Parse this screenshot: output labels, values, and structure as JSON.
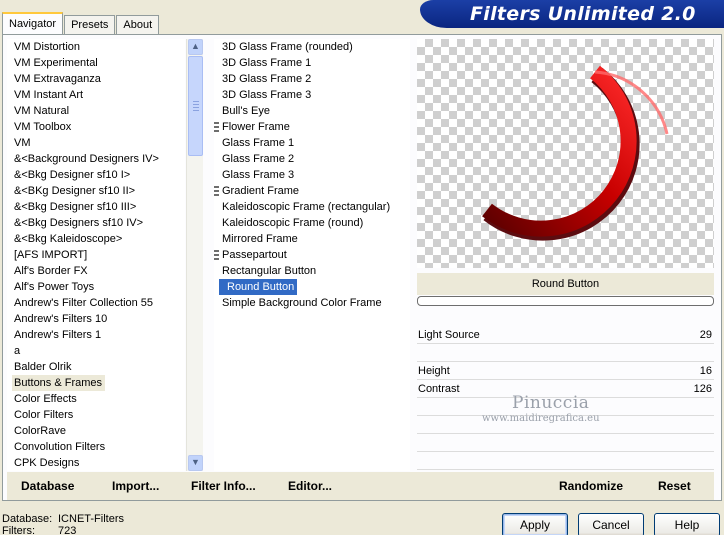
{
  "app": {
    "title": "Filters Unlimited 2.0"
  },
  "tabs": [
    {
      "label": "Navigator",
      "active": true
    },
    {
      "label": "Presets",
      "active": false
    },
    {
      "label": "About",
      "active": false
    }
  ],
  "categories": [
    "VM Distortion",
    "VM Experimental",
    "VM Extravaganza",
    "VM Instant Art",
    "VM Natural",
    "VM Toolbox",
    "VM",
    "&<Background Designers IV>",
    "&<Bkg Designer sf10 I>",
    "&<BKg Designer sf10 II>",
    "&<Bkg Designer sf10 III>",
    "&<Bkg Designers sf10 IV>",
    "&<Bkg Kaleidoscope>",
    "[AFS IMPORT]",
    "Alf's Border FX",
    "Alf's Power Toys",
    "Andrew's Filter Collection 55",
    "Andrew's Filters 10",
    "Andrew's Filters 1",
    "a",
    "Balder Olrik",
    "Buttons & Frames",
    "Color Effects",
    "Color Filters",
    "ColorRave",
    "Convolution Filters",
    "CPK Designs"
  ],
  "selected_category": "Buttons & Frames",
  "filters": [
    {
      "label": "3D Glass Frame (rounded)",
      "marked": false
    },
    {
      "label": "3D Glass Frame 1",
      "marked": false
    },
    {
      "label": "3D Glass Frame 2",
      "marked": false
    },
    {
      "label": "3D Glass Frame 3",
      "marked": false
    },
    {
      "label": "Bull's Eye",
      "marked": false
    },
    {
      "label": "Flower Frame",
      "marked": true
    },
    {
      "label": "Glass Frame 1",
      "marked": false
    },
    {
      "label": "Glass Frame 2",
      "marked": false
    },
    {
      "label": "Glass Frame 3",
      "marked": false
    },
    {
      "label": "Gradient Frame",
      "marked": true
    },
    {
      "label": "Kaleidoscopic Frame (rectangular)",
      "marked": false
    },
    {
      "label": "Kaleidoscopic Frame (round)",
      "marked": false
    },
    {
      "label": "Mirrored Frame",
      "marked": false
    },
    {
      "label": "Passepartout",
      "marked": true
    },
    {
      "label": "Rectangular Button",
      "marked": false
    },
    {
      "label": "Round Button",
      "marked": false
    },
    {
      "label": "Simple Background Color Frame",
      "marked": false
    }
  ],
  "selected_filter": "Round Button",
  "preview": {
    "filter_name": "Round Button",
    "progress": 0
  },
  "params": [
    {
      "label": "Light Source",
      "value": "29"
    },
    {
      "label": "",
      "value": ""
    },
    {
      "label": "Height",
      "value": "16"
    },
    {
      "label": "Contrast",
      "value": "126"
    }
  ],
  "watermark": {
    "line1": "Pinuccia",
    "line2": "www.maidiregrafica.eu"
  },
  "toolbar": {
    "database": "Database",
    "import": "Import...",
    "filter_info": "Filter Info...",
    "editor": "Editor...",
    "randomize": "Randomize",
    "reset": "Reset"
  },
  "status": {
    "database_label": "Database:",
    "database_value": "ICNET-Filters",
    "filters_label": "Filters:",
    "filters_value": "723"
  },
  "buttons": {
    "apply": "Apply",
    "cancel": "Cancel",
    "help": "Help"
  },
  "colors": {
    "selection": "#316ac5",
    "banner": "#0a2580",
    "ring_dark": "#6b0000",
    "ring_light": "#ff2a2a"
  }
}
